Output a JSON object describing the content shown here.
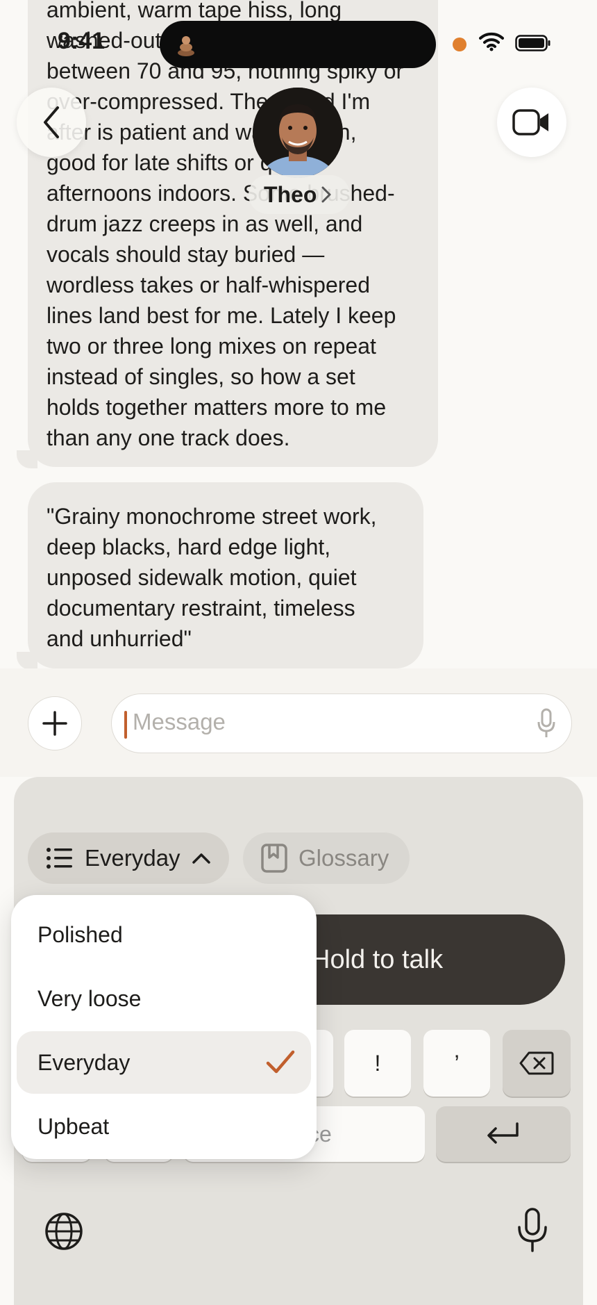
{
  "status_bar": {
    "time": "9:41"
  },
  "header": {
    "contact_name": "Theo"
  },
  "messages": [
    {
      "lines": [
        "ambient, warm tape hiss, long",
        "washed-out pads, tempos",
        "between 70 and 95, nothing spiky or",
        "over-compressed. The sound I'm",
        "after is patient and warm, even,",
        "good for late shifts or quiet",
        "afternoons indoors. Some brushed-",
        "drum jazz creeps in as well, and",
        "vocals should stay buried —",
        "wordless takes or half-whispered",
        "lines land best for me. Lately I keep",
        "two or three long mixes on repeat",
        "instead of singles, so how a set",
        "holds together matters more to me",
        "than any one track does."
      ]
    },
    {
      "lines": [
        "\"Grainy monochrome street work,",
        "deep blacks, hard edge light,",
        "unposed sidewalk motion, quiet",
        "documentary restraint, timeless",
        "and unhurried\""
      ]
    }
  ],
  "composer": {
    "placeholder": "Message"
  },
  "keyboard": {
    "style_chip_label": "Everyday",
    "glossary_chip_label": "Glossary",
    "hold_to_talk_label": "Hold to talk",
    "keys": {
      "exclaim": "!",
      "apostrophe": "’",
      "space_fragment": "ce"
    }
  },
  "style_menu": {
    "items": [
      "Polished",
      "Very loose",
      "Everyday",
      "Upbeat"
    ],
    "selected": "Everyday"
  },
  "colors": {
    "accent": "#c15f2d",
    "notification_dot": "#e0802e",
    "hold_to_talk_bg": "#3a3632"
  }
}
